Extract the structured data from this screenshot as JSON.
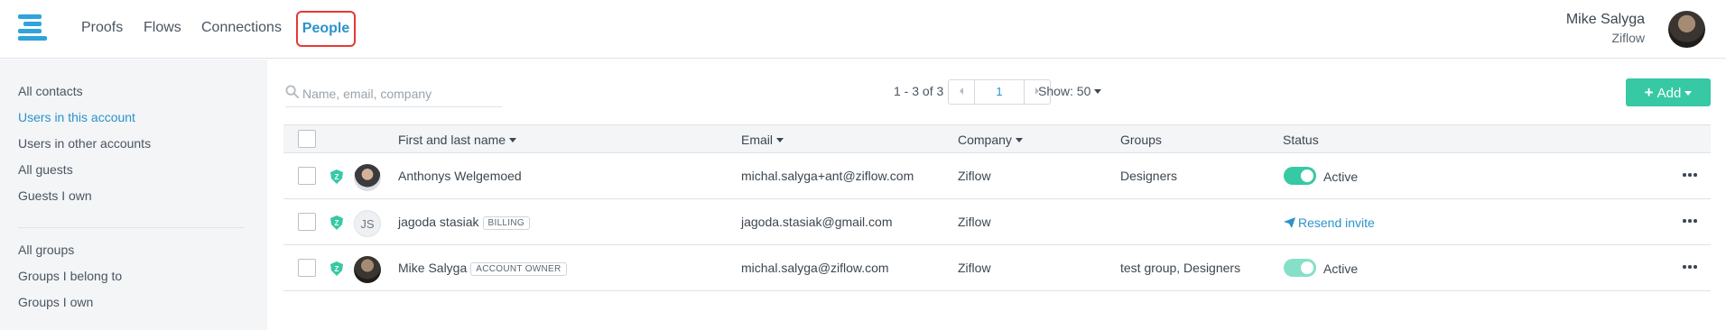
{
  "header": {
    "nav": [
      "Proofs",
      "Flows",
      "Connections",
      "People"
    ],
    "user_name": "Mike Salyga",
    "user_org": "Ziflow"
  },
  "sidebar": {
    "items": [
      "All contacts",
      "Users in this account",
      "Users in other accounts",
      "All guests",
      "Guests I own"
    ],
    "groups": [
      "All groups",
      "Groups I belong to",
      "Groups I own"
    ],
    "active": "Users in this account"
  },
  "toolbar": {
    "search_placeholder": "Name, email, company",
    "count": "1 - 3 of 3",
    "page": "1",
    "show": "Show: 50",
    "add_label": "Add"
  },
  "table": {
    "headers": [
      "First and last name",
      "Email",
      "Company",
      "Groups",
      "Status"
    ],
    "rows": [
      {
        "name": "Anthonys Welgemoed",
        "badge": "",
        "email": "michal.salyga+ant@ziflow.com",
        "company": "Ziflow",
        "groups": "Designers",
        "status": "Active"
      },
      {
        "name": "jagoda stasiak",
        "badge": "BILLING",
        "initials": "JS",
        "email": "jagoda.stasiak@gmail.com",
        "company": "Ziflow",
        "groups": "",
        "status": "Resend invite"
      },
      {
        "name": "Mike Salyga",
        "badge": "ACCOUNT OWNER",
        "email": "michal.salyga@ziflow.com",
        "company": "Ziflow",
        "groups": "test group, Designers",
        "status": "Active"
      }
    ]
  },
  "colors": {
    "accent": "#2b93c9",
    "add_button": "#36c9a4",
    "highlight_border": "#e53935"
  }
}
